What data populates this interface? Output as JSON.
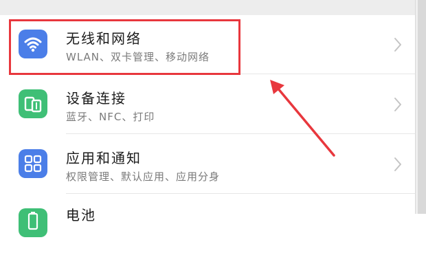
{
  "settings": {
    "items": [
      {
        "title": "无线和网络",
        "subtitle": "WLAN、双卡管理、移动网络",
        "icon": "wifi-icon",
        "icon_color": "#4b7ee8"
      },
      {
        "title": "设备连接",
        "subtitle": "蓝牙、NFC、打印",
        "icon": "device-connection-icon",
        "icon_color": "#3fbf76"
      },
      {
        "title": "应用和通知",
        "subtitle": "权限管理、默认应用、应用分身",
        "icon": "apps-grid-icon",
        "icon_color": "#4b7ee8"
      },
      {
        "title": "电池",
        "subtitle": "",
        "icon": "battery-icon",
        "icon_color": "#3fbf76"
      }
    ]
  },
  "annotation": {
    "highlight_color": "#e8373d",
    "arrow_color": "#e8373d"
  }
}
